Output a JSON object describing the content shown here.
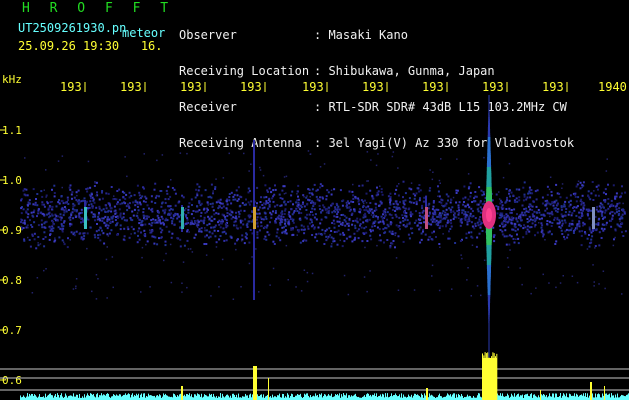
{
  "header": {
    "brand": "H R O F F T",
    "filename": "UT2509261930.pn",
    "suffix": "meteor",
    "stamp": "25.09.26 19:30   16.",
    "meta_labels": [
      "Observer",
      "Receiving Location",
      "Receiver",
      "Receiving Antenna"
    ],
    "meta_values": [
      ": Masaki Kano",
      ": Shibukawa, Gunma, Japan",
      ": RTL-SDR SDR# 43dB L15 103.2MHz CW",
      ": 3el Yagi(V) Az 330 for Vladivostok"
    ]
  },
  "axis": {
    "unit": "kHz",
    "y_ticks": [
      "1.1",
      "1.0",
      "0.9",
      "0.8",
      "0.7",
      "0.6"
    ],
    "x_ticks": [
      "193",
      "193",
      "193",
      "193",
      "193",
      "193",
      "193",
      "193",
      "193",
      "1940"
    ]
  },
  "colors": {
    "text_green": "#22dd22",
    "text_yellow": "#ffff33",
    "text_white": "#f0f0f0",
    "level_cyan": "#66ffff"
  }
}
